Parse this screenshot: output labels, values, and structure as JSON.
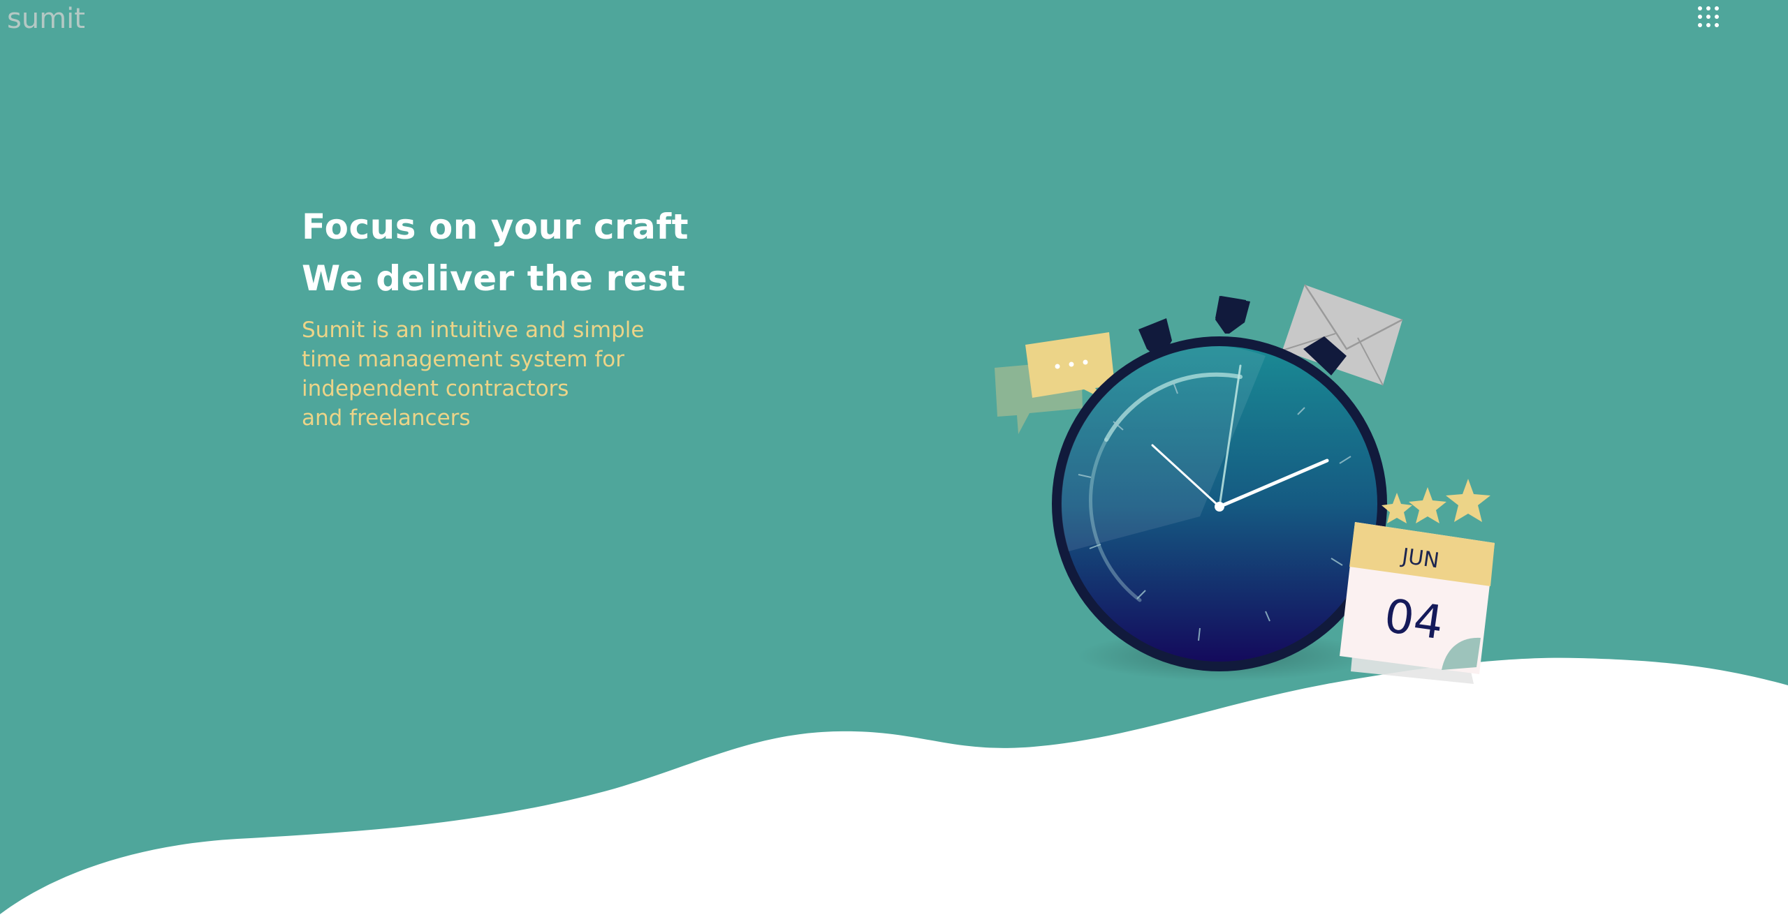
{
  "brand": {
    "logo_text": "sumit"
  },
  "header": {
    "apps_icon": "grid-dots-icon"
  },
  "hero": {
    "headline_line1": "Focus on your craft",
    "headline_line2": "We deliver the rest",
    "subtitle_lines": [
      "Sumit is an intuitive and simple",
      "time management system for",
      "independent contractors",
      "and freelancers"
    ]
  },
  "illustration": {
    "calendar_month": "JUN",
    "calendar_day": "04",
    "icons": [
      "stopwatch-icon",
      "chat-bubble-icon",
      "envelope-icon",
      "star-icon",
      "calendar-icon"
    ]
  },
  "colors": {
    "background": "#4fa69b",
    "headline": "#ffffff",
    "subtitle": "#ecd488",
    "logo": "#b4c8c4",
    "wave": "#ffffff",
    "clock_dark": "#111a3c",
    "calendar_header": "#efd38a"
  }
}
